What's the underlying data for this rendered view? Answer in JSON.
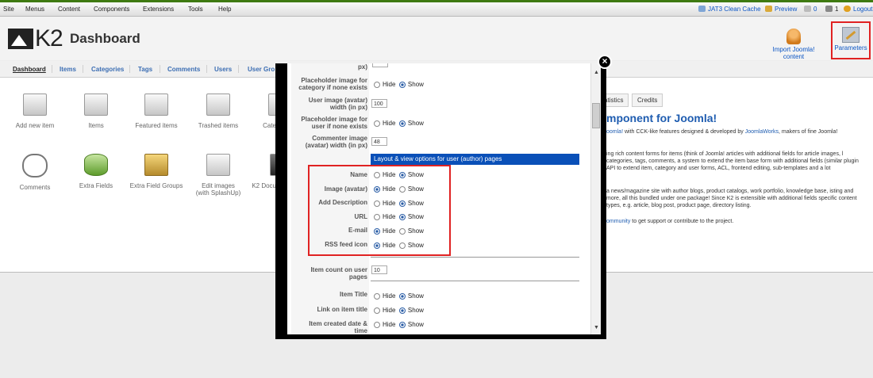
{
  "menubar": {
    "items": [
      "Site",
      "Menus",
      "Content",
      "Components",
      "Extensions",
      "Tools",
      "Help"
    ],
    "right": {
      "cache": "JAT3 Clean Cache",
      "preview": "Preview",
      "count1": "0",
      "count2": "1",
      "logout": "Logout"
    }
  },
  "header": {
    "logo_text": "K2",
    "title": "Dashboard",
    "import_label": "Import Joomla! content",
    "parameters_label": "Parameters"
  },
  "subnav": {
    "tabs": [
      "Dashboard",
      "Items",
      "Categories",
      "Tags",
      "Comments",
      "Users",
      "User Gro"
    ]
  },
  "dashboard": {
    "icons_row1": [
      "Add new item",
      "Items",
      "Featured items",
      "Trashed items",
      "Cate"
    ],
    "icons_row2": [
      "Comments",
      "Extra Fields",
      "Extra Field Groups",
      "Edit images (with SplashUp)",
      "K2 Docu"
    ],
    "edit_images_l1": "Edit images",
    "edit_images_l2": "(with SplashUp)",
    "right_tabs": [
      "atistics",
      "Credits"
    ],
    "right_title": "mponent for Joomla!",
    "right_p1a": "oomla!",
    "right_p1b": " with CCK-like features designed & developed by ",
    "right_p1c": "JoomlaWorks",
    "right_p1d": ", makers of fine Joomla!",
    "right_p2": "ing rich content forms for items (think of Joomla! articles with additional fields for article images, l categories, tags, comments, a system to extend the item base form with additional fields (similar plugin API to extend item, category and user forms, ACL, frontend editing, sub-templates and a lot",
    "right_p3": "a news/magazine site with author blogs, product catalogs, work portfolio, knowledge base, isting and more, all this bundled under one package! Since K2 is extensible with additional fields specific content types, e.g. article, blog post, product page, directory listing.",
    "right_p4a": "ommunity",
    "right_p4b": " to get support or contribute to the project."
  },
  "modal": {
    "close": "×",
    "partial_label": "px)",
    "rows_top": [
      {
        "label": "Placeholder image for category if none exists",
        "hide": "Hide",
        "show": "Show",
        "selected": "show"
      },
      {
        "label": "User image (avatar) width (in px)",
        "value": "100"
      },
      {
        "label": "Placeholder image for user if none exists",
        "hide": "Hide",
        "show": "Show",
        "selected": "show"
      },
      {
        "label": "Commenter image (avatar) width (in px)",
        "value": "48"
      }
    ],
    "section_title": "Layout & view options for user (author) pages",
    "user_rows": [
      {
        "label": "Name",
        "hide": "Hide",
        "show": "Show",
        "selected": "show"
      },
      {
        "label": "Image (avatar)",
        "hide": "Hide",
        "show": "Show",
        "selected": "hide"
      },
      {
        "label": "Add Description",
        "hide": "Hide",
        "show": "Show",
        "selected": "show"
      },
      {
        "label": "URL",
        "hide": "Hide",
        "show": "Show",
        "selected": "show"
      },
      {
        "label": "E-mail",
        "hide": "Hide",
        "show": "Show",
        "selected": "hide"
      },
      {
        "label": "RSS feed icon",
        "hide": "Hide",
        "show": "Show",
        "selected": "hide"
      }
    ],
    "item_count_label": "Item count on user pages",
    "item_count_value": "10",
    "item_rows": [
      {
        "label": "Item Title",
        "hide": "Hide",
        "show": "Show",
        "selected": "show"
      },
      {
        "label": "Link on item title",
        "hide": "Hide",
        "show": "Show",
        "selected": "show"
      },
      {
        "label": "Item created date & time",
        "hide": "Hide",
        "show": "Show",
        "selected": "show"
      }
    ]
  },
  "colors": {
    "accent": "#0a50b8",
    "highlight": "#e02222",
    "link": "#0b55c4"
  }
}
